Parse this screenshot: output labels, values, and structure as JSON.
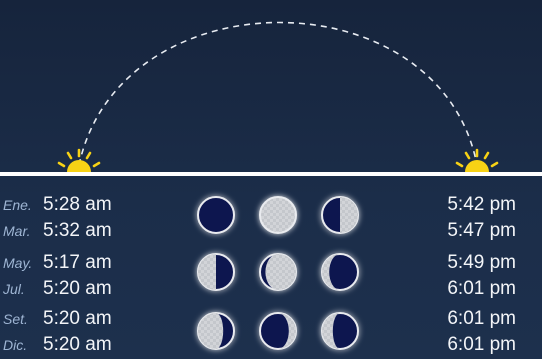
{
  "colors": {
    "background": "#1b2d49",
    "sun": "#f7d215",
    "moon_light": "#d4d6da",
    "moon_dark": "#0d1550",
    "horizon": "#ffffff",
    "month_text": "#9eb5d3",
    "time_text": "#f3f5f8"
  },
  "icons": {
    "sunrise": "sunrise-icon",
    "sunset": "sunset-icon",
    "sun_path": "dashed-arc"
  },
  "rows": [
    {
      "month": "Ene.",
      "sunrise": "5:28 am",
      "sunset": "5:42 pm"
    },
    {
      "month": "Mar.",
      "sunrise": "5:32 am",
      "sunset": "5:47 pm"
    },
    {
      "month": "May.",
      "sunrise": "5:17 am",
      "sunset": "5:49 pm"
    },
    {
      "month": "Jul.",
      "sunrise": "5:20 am",
      "sunset": "6:01 pm"
    },
    {
      "month": "Set.",
      "sunrise": "5:20 am",
      "sunset": "6:01 pm"
    },
    {
      "month": "Dic.",
      "sunrise": "5:20 am",
      "sunset": "6:01 pm"
    }
  ],
  "moon_phases": [
    {
      "name": "new-moon",
      "lit_fraction": 0.0,
      "lit_side": "none"
    },
    {
      "name": "full-moon",
      "lit_fraction": 1.0,
      "lit_side": "both"
    },
    {
      "name": "first-quarter",
      "lit_fraction": 0.5,
      "lit_side": "right"
    },
    {
      "name": "last-quarter",
      "lit_fraction": 0.5,
      "lit_side": "left"
    },
    {
      "name": "waxing-gibbous",
      "lit_fraction": 0.85,
      "lit_side": "right"
    },
    {
      "name": "waning-crescent",
      "lit_fraction": 0.2,
      "lit_side": "left"
    },
    {
      "name": "waning-gibbous",
      "lit_fraction": 0.7,
      "lit_side": "left"
    },
    {
      "name": "waxing-crescent",
      "lit_fraction": 0.2,
      "lit_side": "right"
    },
    {
      "name": "waning-crescent-2",
      "lit_fraction": 0.3,
      "lit_side": "left"
    }
  ]
}
